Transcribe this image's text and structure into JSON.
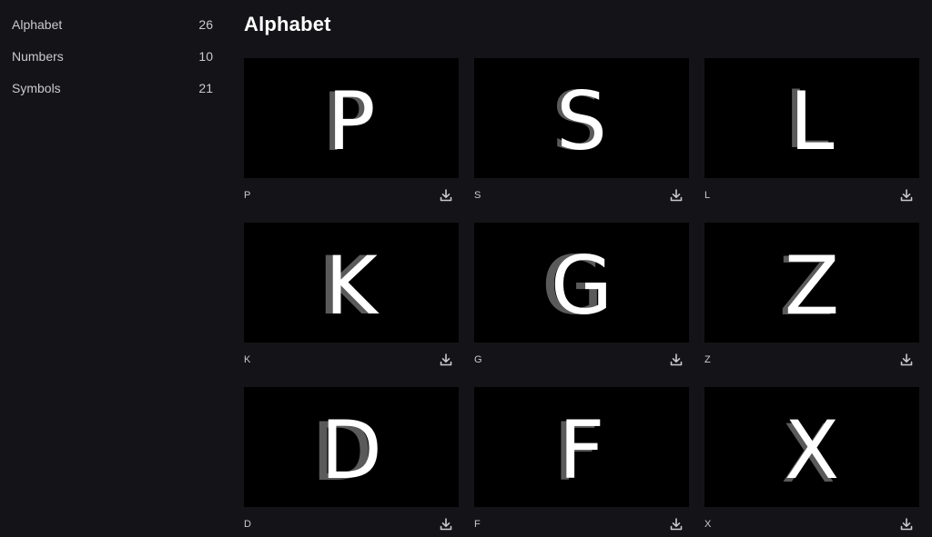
{
  "sidebar": {
    "categories": [
      {
        "label": "Alphabet",
        "count": "26"
      },
      {
        "label": "Numbers",
        "count": "10"
      },
      {
        "label": "Symbols",
        "count": "21"
      }
    ]
  },
  "main": {
    "title": "Alphabet",
    "items": [
      {
        "label": "P",
        "glyph": "P"
      },
      {
        "label": "S",
        "glyph": "S"
      },
      {
        "label": "L",
        "glyph": "L"
      },
      {
        "label": "K",
        "glyph": "K"
      },
      {
        "label": "G",
        "glyph": "G"
      },
      {
        "label": "Z",
        "glyph": "Z"
      },
      {
        "label": "D",
        "glyph": "D"
      },
      {
        "label": "F",
        "glyph": "F"
      },
      {
        "label": "X",
        "glyph": "X"
      }
    ],
    "download_icon": "download-icon"
  },
  "colors": {
    "background": "#141418",
    "thumbnail": "#000000",
    "glyph_main": "#ffffff",
    "glyph_shadow": "#6a6a6a",
    "text": "#c9c9cf"
  }
}
